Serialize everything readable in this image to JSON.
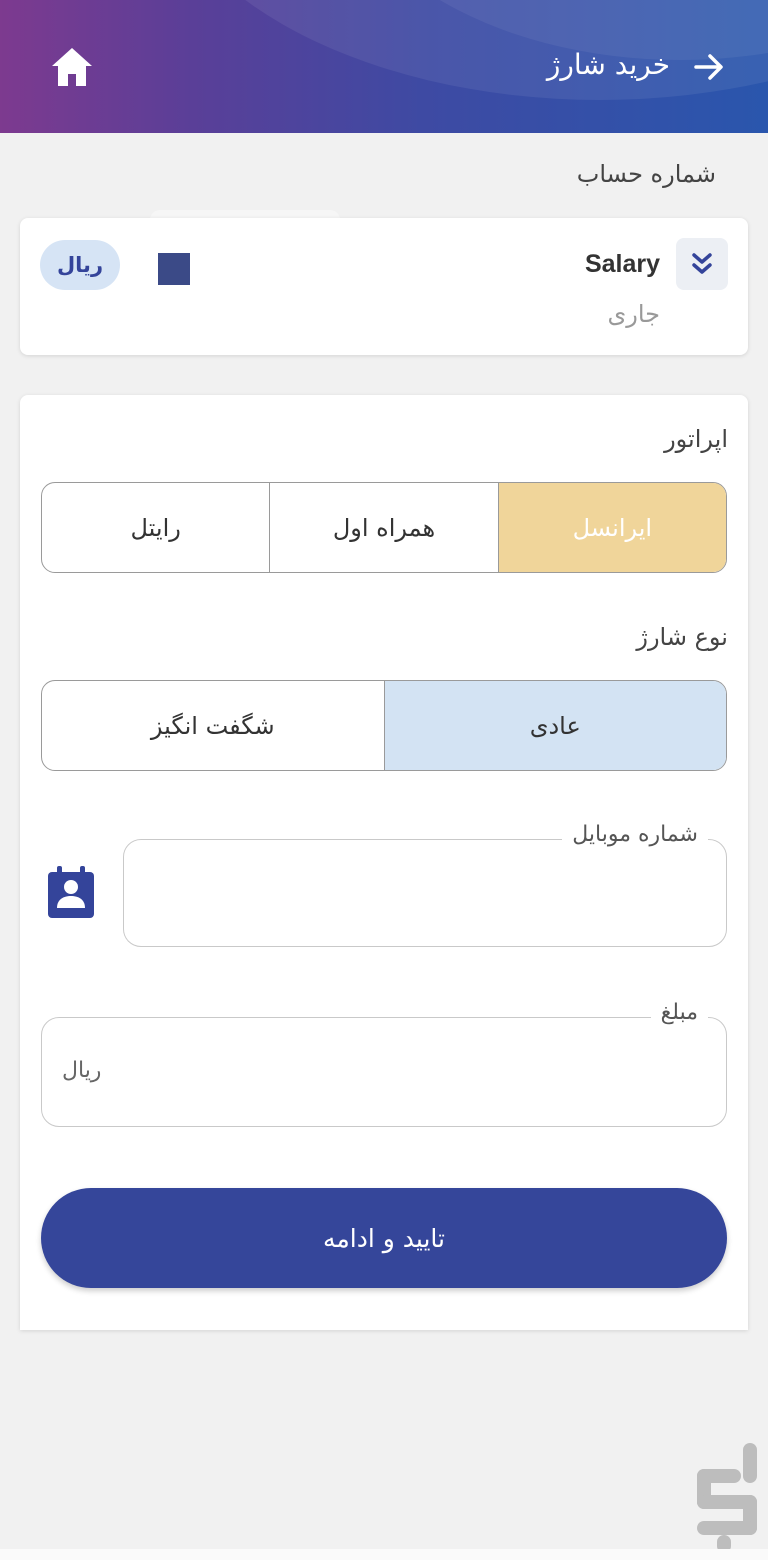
{
  "header": {
    "title": "خرید شارژ",
    "home_icon": "home-icon",
    "back_icon": "arrow-right-icon"
  },
  "account": {
    "section_label": "شماره حساب",
    "name": "Salary",
    "type": "جاری",
    "currency": "ریال",
    "expand_icon": "double-chevron-down-icon",
    "color_square": "#3b4a87"
  },
  "operator": {
    "label": "اپراتور",
    "options": [
      "ایرانسل",
      "همراه اول",
      "رایتل"
    ],
    "selected": "ایرانسل"
  },
  "charge_type": {
    "label": "نوع شارژ",
    "options": [
      "عادی",
      "شگفت انگیز"
    ],
    "selected": "عادی"
  },
  "mobile": {
    "label": "شماره موبایل",
    "value": "",
    "contact_icon": "contact-book-icon"
  },
  "amount": {
    "label": "مبلغ",
    "value": "",
    "unit": "ریال"
  },
  "submit": {
    "label": "تایید و ادامه"
  },
  "colors": {
    "primary": "#35469a",
    "selected_operator": "#f0d59a",
    "selected_type": "#d3e3f3"
  }
}
